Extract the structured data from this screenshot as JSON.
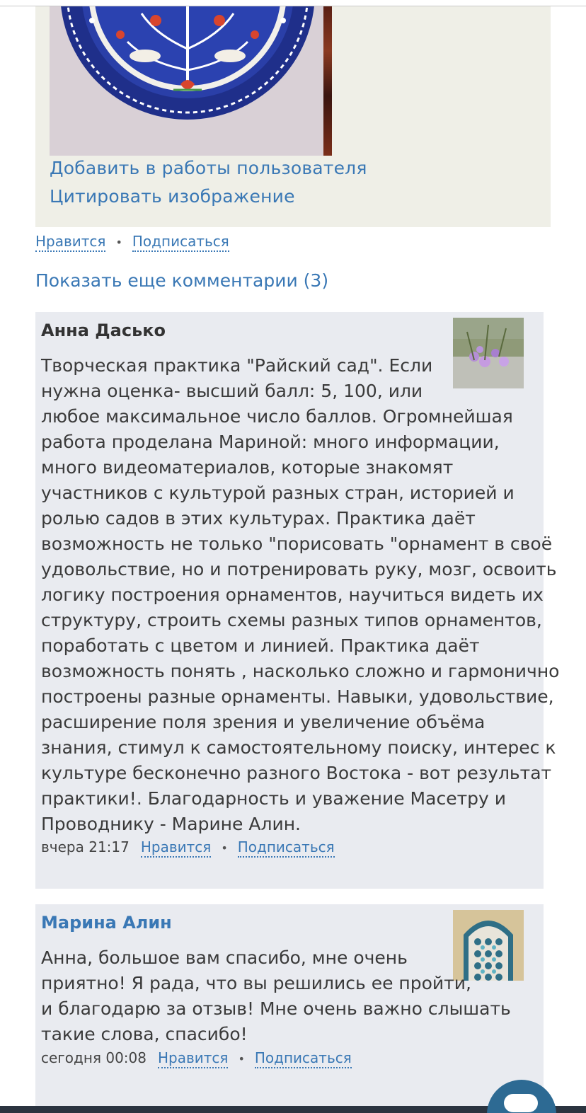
{
  "image_block": {
    "image_alt": "Blue floral ornament plate",
    "add_to_works": "Добавить в работы пользователя",
    "cite_image": "Цитировать изображение"
  },
  "post_actions": {
    "like": "Нравится",
    "subscribe": "Подписаться"
  },
  "show_more_comments": "Показать еще комментарии (3)",
  "comments": [
    {
      "author": "Анна Дасько",
      "avatar": "flower-photo-avatar",
      "text_lines": [
        "Творческая практика \"Райский сад\". Если",
        "нужна оценка- высший балл: 5, 100, или",
        "любое максимальное число баллов. Огромнейшая",
        "работа проделана Мариной: много информации,",
        "много видеоматериалов, которые знакомят",
        "участников с культурой разных стран, историей и",
        "ролью садов в этих культурах. Практика даёт",
        "возможность не только \"порисовать \"орнамент в своё",
        "удовольствие, но и потренировать руку, мозг, освоить",
        "логику построения орнаментов, научиться видеть их",
        "структуру, строить схемы разных типов орнаментов,",
        "поработать с цветом и линией. Практика даёт",
        "возможность понять , насколько сложно и гармонично",
        "построены разные орнаменты. Навыки, удовольствие,",
        "расширение поля зрения и увеличение объёма",
        "знания, стимул к самостоятельному поиску, интерес к",
        "культуре бесконечно разного Востока - вот результат",
        "практики!. Благодарность и уважение Масетру и",
        "Проводнику - Марине Алин."
      ],
      "time": "вчера 21:17",
      "like": "Нравится",
      "subscribe": "Подписаться"
    },
    {
      "author": "Марина Алин",
      "avatar": "tile-mosaic-avatar",
      "text_lines": [
        "Анна, большое вам спасибо, мне очень",
        "приятно! Я рада, что вы решились ее пройти,",
        "и благодарю за отзыв! Мне очень важно слышать",
        "такие слова, спасибо!"
      ],
      "time": "сегодня 00:08",
      "like": "Нравится",
      "subscribe": "Подписаться"
    }
  ],
  "chat_icon": "chat-bubble-icon",
  "colors": {
    "link": "#3a78b5",
    "comment_bg": "#e9ebf0",
    "image_block_bg": "#efefe7",
    "chat_button": "#2d6a93"
  }
}
